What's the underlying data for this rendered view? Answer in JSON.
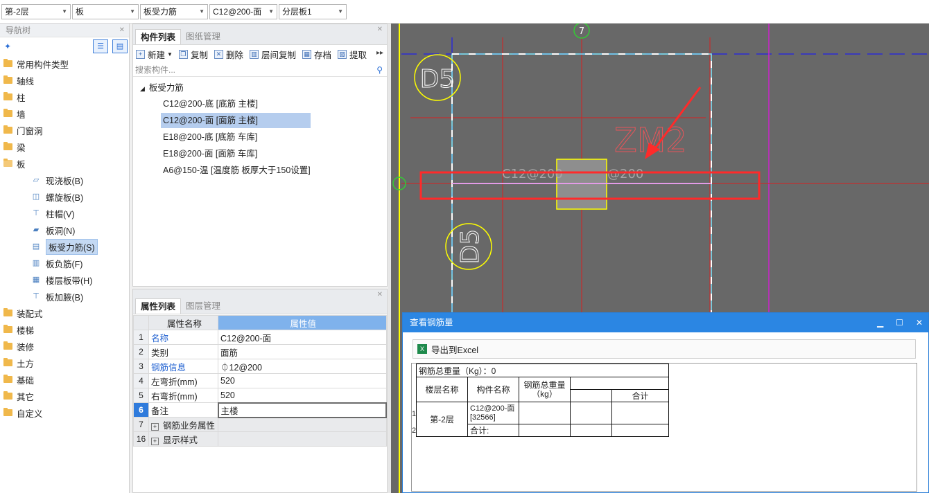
{
  "toolbar": {
    "floor": "第-2层",
    "type": "板",
    "subtype": "板受力筋",
    "component": "C12@200-面",
    "layer": "分层板1"
  },
  "nav": {
    "title": "导航树",
    "items": [
      {
        "label": "常用构件类型"
      },
      {
        "label": "轴线"
      },
      {
        "label": "柱"
      },
      {
        "label": "墙"
      },
      {
        "label": "门窗洞"
      },
      {
        "label": "梁"
      },
      {
        "label": "板"
      }
    ],
    "subitems": [
      {
        "label": "现浇板(B)"
      },
      {
        "label": "螺旋板(B)"
      },
      {
        "label": "柱帽(V)"
      },
      {
        "label": "板洞(N)"
      },
      {
        "label": "板受力筋(S)"
      },
      {
        "label": "板负筋(F)"
      },
      {
        "label": "楼层板带(H)"
      },
      {
        "label": "板加腋(B)"
      }
    ],
    "items_after": [
      {
        "label": "装配式"
      },
      {
        "label": "楼梯"
      },
      {
        "label": "装修"
      },
      {
        "label": "土方"
      },
      {
        "label": "基础"
      },
      {
        "label": "其它"
      },
      {
        "label": "自定义"
      }
    ]
  },
  "comp": {
    "tab_active": "构件列表",
    "tab_other": "图纸管理",
    "tools": [
      "新建",
      "复制",
      "删除",
      "层间复制",
      "存档",
      "提取"
    ],
    "search_placeholder": "搜索构件...",
    "root": "板受力筋",
    "items": [
      "C12@200-底 [底筋 主楼]",
      "C12@200-面 [面筋 主楼]",
      "E18@200-底 [底筋 车库]",
      "E18@200-面 [面筋 车库]",
      "A6@150-温 [温度筋 板厚大于150设置]"
    ]
  },
  "prop": {
    "tab_active": "属性列表",
    "tab_other": "图层管理",
    "col_name": "属性名称",
    "col_value": "属性值",
    "rows": [
      {
        "num": "1",
        "key": "名称",
        "value": "C12@200-面"
      },
      {
        "num": "2",
        "key": "类别",
        "value": "面筋"
      },
      {
        "num": "3",
        "key": "钢筋信息",
        "value": "⏀12@200"
      },
      {
        "num": "4",
        "key": "左弯折(mm)",
        "value": "520"
      },
      {
        "num": "5",
        "key": "右弯折(mm)",
        "value": "520"
      },
      {
        "num": "6",
        "key": "备注",
        "value": "主楼"
      },
      {
        "num": "7",
        "key": "钢筋业务属性",
        "value": ""
      },
      {
        "num": "16",
        "key": "显示样式",
        "value": ""
      }
    ]
  },
  "canvas": {
    "axis_label": "7",
    "d5_label": "D5",
    "zm_label": "ZM2",
    "rebar_left": "C12@200",
    "rebar_right": "@200"
  },
  "dialog": {
    "title": "查看钢筋量",
    "export": "导出到Excel",
    "total": "钢筋总重量（Kg）：0",
    "h_floor": "楼层名称",
    "h_name": "构件名称",
    "h_weight1": "钢筋总重量",
    "h_weight2": "（kg）",
    "h_sum": "合计",
    "floor": "第-2层",
    "comp_name": "C12@200-面[32566]",
    "subtotal": "合计:",
    "row1": "1",
    "row2": "2"
  },
  "colors": {
    "accent": "#2b86e3",
    "highlight": "#ff2a2a",
    "canvas_bg": "#686868"
  }
}
